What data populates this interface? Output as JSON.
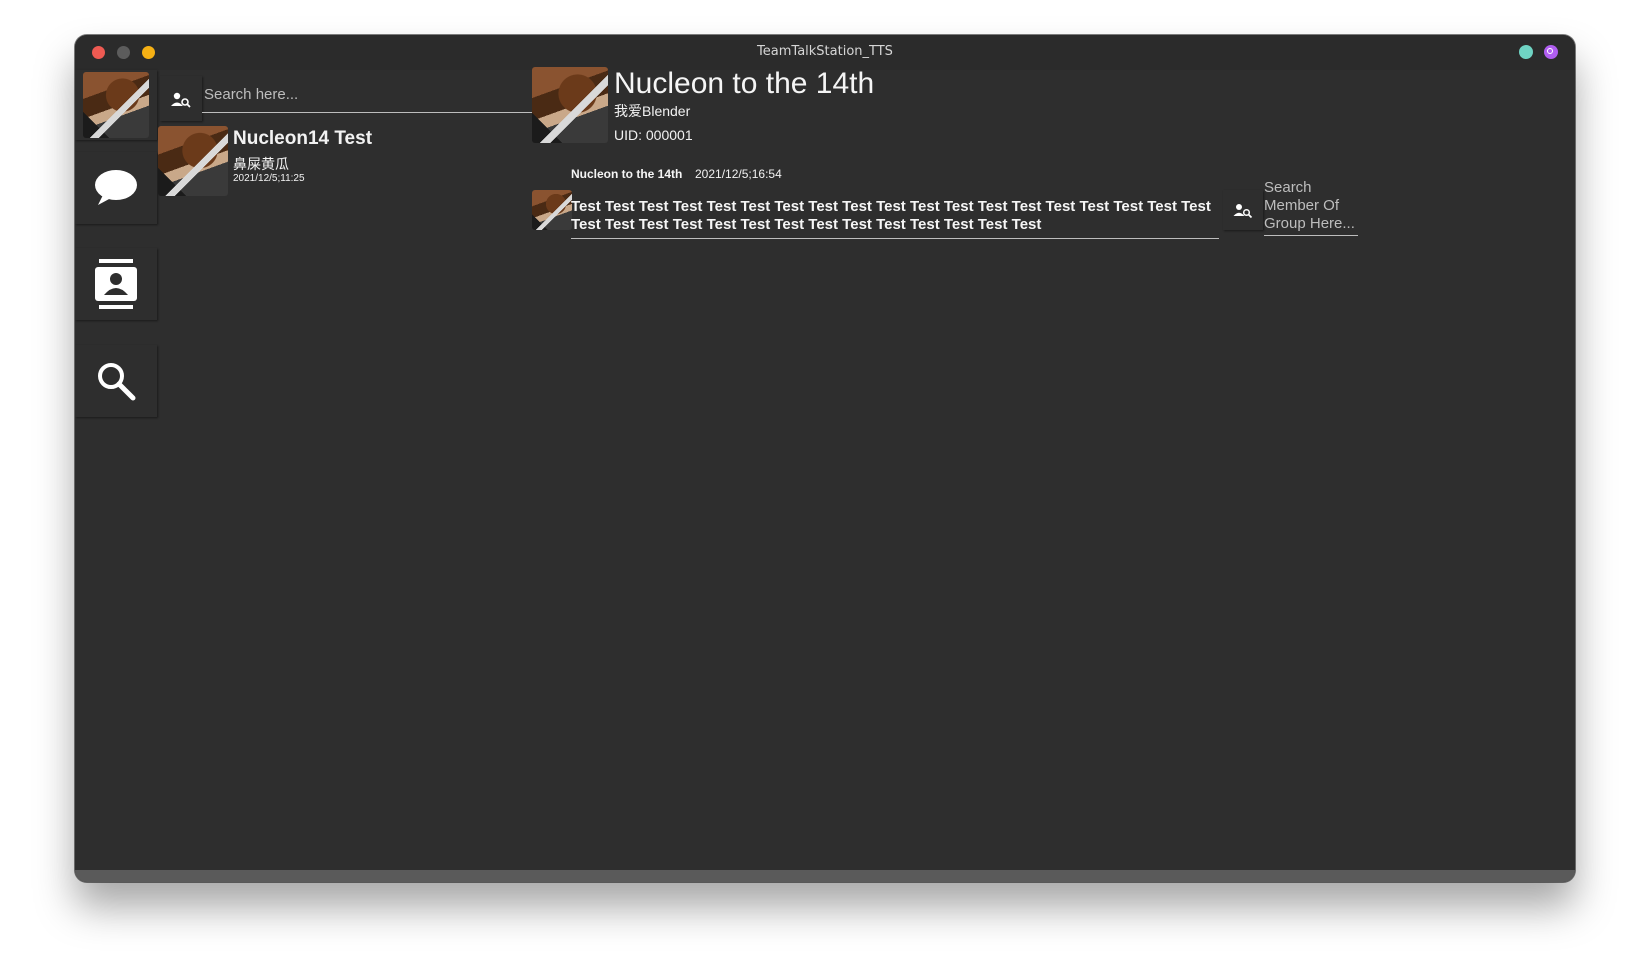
{
  "window": {
    "title": "TeamTalkStation_TTS"
  },
  "sidebar": {
    "items": [
      {
        "name": "profile-avatar",
        "icon": "avatar-image"
      },
      {
        "name": "chats",
        "icon": "chat-bubble-icon"
      },
      {
        "name": "contacts",
        "icon": "contacts-book-icon"
      },
      {
        "name": "search",
        "icon": "search-icon"
      }
    ]
  },
  "contact_search": {
    "placeholder": "Search here...",
    "icon": "person-search-icon"
  },
  "contacts": [
    {
      "name": "Nucleon14 Test",
      "subtitle": "鼻屎黄瓜",
      "time": "2021/12/5;11:25"
    }
  ],
  "chat": {
    "title": "Nucleon to the 14th",
    "subtitle": "我爱Blender",
    "uid": "UID: 000001",
    "messages": [
      {
        "sender": "Nucleon to the 14th",
        "time": "2021/12/5;16:54",
        "text": "Test Test Test Test Test Test Test Test Test Test Test Test Test Test Test Test Test Test Test Test Test Test Test Test Test Test Test Test Test Test Test Test Test"
      }
    ]
  },
  "member_search": {
    "placeholder": "Search Member Of Group Here...",
    "icon": "person-search-icon"
  },
  "colors": {
    "background": "#2e2e2e",
    "titlebar": "#2b2b2b",
    "close": "#ee5a52",
    "minimize": "#5c5c5c",
    "maximize": "#f5b014",
    "teal_indicator": "#6fd3c3",
    "purple_indicator": "#b05ef0"
  }
}
